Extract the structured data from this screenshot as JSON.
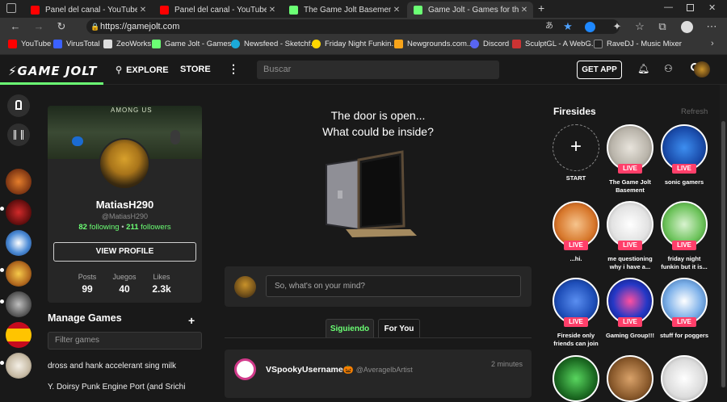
{
  "browser": {
    "tabs": [
      {
        "title": "Panel del canal - YouTube Studio",
        "favicon_color": "#ff0000"
      },
      {
        "title": "Panel del canal - YouTube Studio",
        "favicon_color": "#ff0000"
      },
      {
        "title": "The Game Jolt Basement - Firesid",
        "favicon_color": "#6bff74"
      },
      {
        "title": "Game Jolt - Games for the love o",
        "favicon_color": "#6bff74"
      }
    ],
    "new_tab": "+",
    "url": "https://gamejolt.com",
    "bookmarks": [
      {
        "label": "YouTube",
        "icon_color": "#ff0000"
      },
      {
        "label": "VirusTotal",
        "icon_color": "#3b61ff"
      },
      {
        "label": "ZeoWorks",
        "icon_color": "#dddddd"
      },
      {
        "label": "Game Jolt - Games...",
        "icon_color": "#6bff74"
      },
      {
        "label": "Newsfeed - Sketchf...",
        "icon_color": "#1caad9"
      },
      {
        "label": "Friday Night Funkin...",
        "icon_color": "#ffd700"
      },
      {
        "label": "Newgrounds.com...",
        "icon_color": "#f8a41a"
      },
      {
        "label": "Discord",
        "icon_color": "#5865f2"
      },
      {
        "label": "SculptGL - A WebG...",
        "icon_color": "#cc3333"
      },
      {
        "label": "RaveDJ - Music Mixer",
        "icon_color": "#222222"
      }
    ]
  },
  "gj_nav": {
    "logo": "GAME JOLT",
    "explore": "EXPLORE",
    "store": "STORE",
    "more": "⋮",
    "search_placeholder": "Buscar",
    "get_app": "GET APP",
    "accent": "#6bff74"
  },
  "profile": {
    "banner_text": "AMONG US",
    "display_name": "MatiasH290",
    "username": "@MatiasH290",
    "following_count": "82",
    "following_label": "following",
    "followers_count": "211",
    "followers_label": "followers",
    "view_profile": "VIEW PROFILE",
    "stats": [
      {
        "label": "Posts",
        "value": "99"
      },
      {
        "label": "Juegos",
        "value": "40"
      },
      {
        "label": "Likes",
        "value": "2.3k"
      }
    ]
  },
  "manage_games": {
    "title": "Manage Games",
    "add": "+",
    "filter_placeholder": "Filter games",
    "games": [
      "dross and hank accelerant sing milk",
      "Y. Doirsy Punk Engine Port (and Srichi"
    ]
  },
  "center": {
    "door_line1": "The door is open...",
    "door_line2": "What could be inside?",
    "post_placeholder": "So, what's on your mind?",
    "tabs": [
      "Siguiendo",
      "For You"
    ],
    "feed": [
      {
        "author": "VSpookyUsername",
        "emoji": "🎃",
        "handle": "@AveragelbArtist",
        "time": "2 minutes"
      }
    ]
  },
  "firesides": {
    "title": "Firesides",
    "refresh": "Refresh",
    "start_label": "START",
    "live_label": "LIVE",
    "live_color": "#ff3f6a",
    "items": [
      {
        "caption": "The Game Jolt Basement"
      },
      {
        "caption": "sonic gamers"
      },
      {
        "caption": "...hi."
      },
      {
        "caption": "me questioning why i have a..."
      },
      {
        "caption": "friday night funkin but it is..."
      },
      {
        "caption": "Fireside only friends can join"
      },
      {
        "caption": "Gaming Group!!!"
      },
      {
        "caption": "stuff for poggers"
      }
    ]
  }
}
